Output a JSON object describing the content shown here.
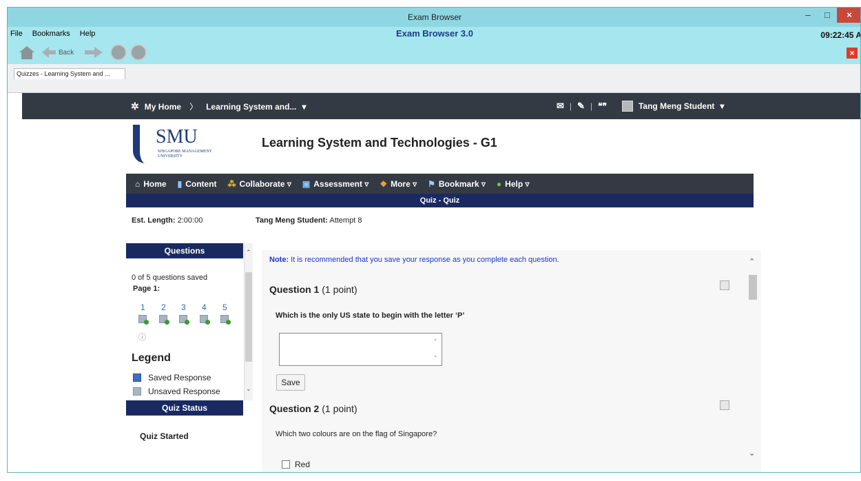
{
  "window": {
    "title": "Exam Browser",
    "minimize_glyph": "–",
    "maximize_glyph": "□",
    "close_glyph": "×"
  },
  "menu": {
    "items": [
      "File",
      "Bookmarks",
      "Help"
    ],
    "app_title": "Exam Browser 3.0",
    "clock": "09:22:45 A"
  },
  "toolbar": {
    "back_label": "Back",
    "buttons": [
      "home-icon",
      "back-arrow-icon",
      "forward-arrow-icon",
      "stop-icon",
      "refresh-icon"
    ],
    "close_glyph": "×"
  },
  "tab": {
    "label": "Quizzes - Learning System and ..."
  },
  "topnav": {
    "home_label": "My Home",
    "sep": "〉",
    "course_label": "Learning System and...",
    "dropdown_glyph": "▾",
    "divider": "|",
    "user_name": "Tang Meng Student",
    "icons": [
      "mail-icon",
      "notifications-icon",
      "chat-icon"
    ]
  },
  "logo": {
    "name": "SMU",
    "subtitle": "SINGAPORE MANAGEMENT UNIVERSITY"
  },
  "course_title": "Learning System and Technologies - G1",
  "coursenav": {
    "items": [
      {
        "label": "Home",
        "icon": "house-icon"
      },
      {
        "label": "Content",
        "icon": "book-icon"
      },
      {
        "label": "Collaborate ▿",
        "icon": "people-icon"
      },
      {
        "label": "Assessment ▿",
        "icon": "clipboard-icon"
      },
      {
        "label": "More ▿",
        "icon": "share-icon"
      },
      {
        "label": "Bookmark ▿",
        "icon": "bookmark-icon"
      },
      {
        "label": "Help ▿",
        "icon": "help-icon"
      }
    ]
  },
  "quiz_bar": "Quiz - Quiz",
  "meta": {
    "est_label": "Est. Length:",
    "est_value": "2:00:00",
    "student_label": "Tang Meng Student:",
    "attempt": "Attempt 8"
  },
  "questions_panel": {
    "title": "Questions",
    "saved_count": "0 of 5 questions saved",
    "page_label": "Page 1:",
    "numbers": [
      "1",
      "2",
      "3",
      "4",
      "5"
    ],
    "info_glyph": "ⓘ"
  },
  "legend": {
    "title": "Legend",
    "items": [
      "Saved Response",
      "Unsaved Response"
    ]
  },
  "status_panel": {
    "title": "Quiz Status",
    "status": "Quiz Started"
  },
  "main": {
    "note_label": "Note:",
    "note_text": " It is recommended that you save your response as you complete each question.",
    "q1_title": "Question 1",
    "q1_points": " (1 point)",
    "q1_text": "Which is the only US state to begin with the letter ‘P’",
    "save_label": "Save",
    "q2_title": "Question 2",
    "q2_points": " (1 point)",
    "q2_text": "Which two colours are on the flag of Singapore?",
    "option_1": "Red"
  },
  "colors": {
    "title_bar": "#8ed7e2",
    "nav_dark": "#333a44",
    "quiz_blue": "#1a2a60",
    "note_blue": "#1d35c8"
  }
}
